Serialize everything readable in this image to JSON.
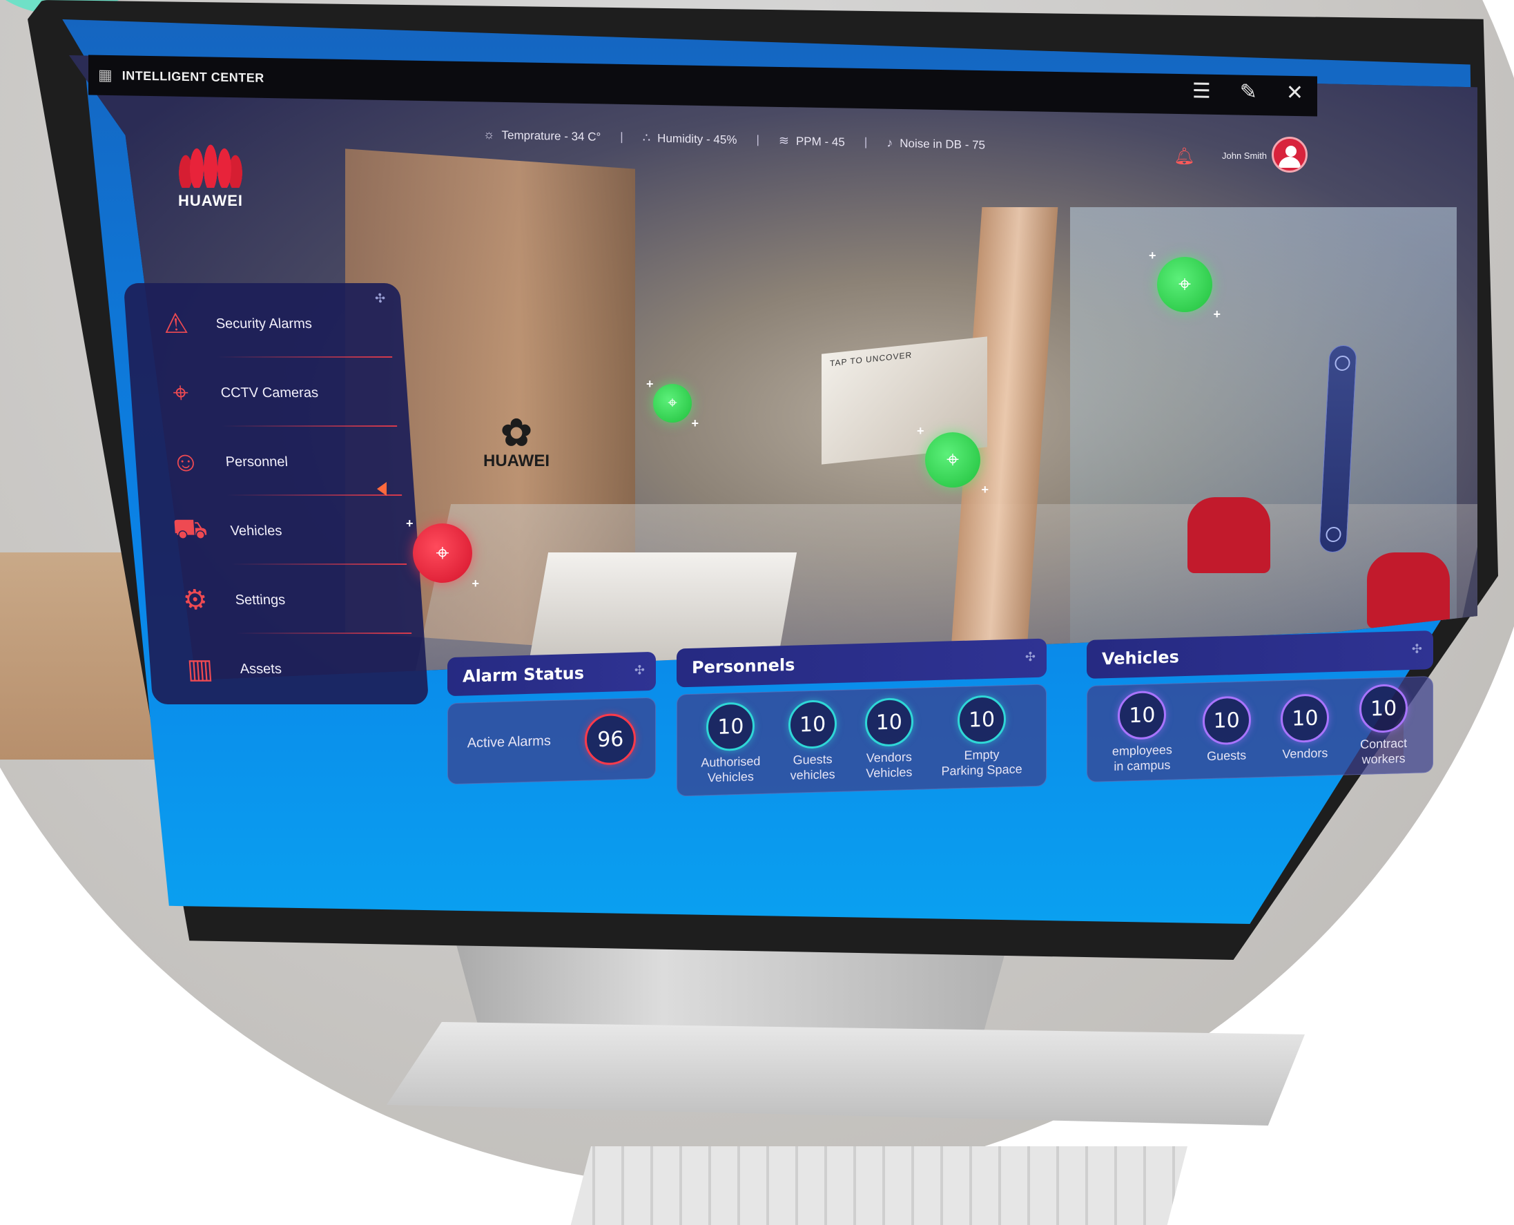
{
  "window": {
    "title": "INTELLIGENT CENTER",
    "app_icon": "building-chart-icon",
    "controls": [
      {
        "name": "filter-settings-icon",
        "glyph": "☰"
      },
      {
        "name": "pin-icon",
        "glyph": "✎"
      },
      {
        "name": "close-icon",
        "glyph": "✕"
      }
    ]
  },
  "brand": {
    "logo_text": "HUAWEI",
    "wall_logo_text": "HUAWEI",
    "primary_color": "#e8233a"
  },
  "environment": [
    {
      "icon": "sun-icon",
      "label": "Temprature - 34 C°"
    },
    {
      "icon": "droplets-icon",
      "label": "Humidity - 45%"
    },
    {
      "icon": "waves-icon",
      "label": "PPM - 45"
    },
    {
      "icon": "microphone-icon",
      "label": "Noise in DB - 75"
    }
  ],
  "user": {
    "name": "John Smith",
    "notification_icon": "bell-icon"
  },
  "scene": {
    "tv_text": "TAP TO UNCOVER"
  },
  "sidebar": {
    "items": [
      {
        "label": "Security Alarms",
        "icon": "alarm-siren-icon",
        "glyph": "⚠"
      },
      {
        "label": "CCTV Cameras",
        "icon": "cctv-camera-icon",
        "glyph": "⌖"
      },
      {
        "label": "Personnel",
        "icon": "personnel-clock-icon",
        "glyph": "☺"
      },
      {
        "label": "Vehicles",
        "icon": "car-icon",
        "glyph": "⛟"
      },
      {
        "label": "Settings",
        "icon": "gears-icon",
        "glyph": "⚙"
      },
      {
        "label": "Assets",
        "icon": "assets-chart-icon",
        "glyph": "▥"
      }
    ]
  },
  "alarm_status": {
    "title": "Alarm Status",
    "label": "Active Alarms",
    "value": "96"
  },
  "personnels": {
    "title": "Personnels",
    "stats": [
      {
        "value": "10",
        "label": "Authorised\nVehicles"
      },
      {
        "value": "10",
        "label": "Guests\nvehicles"
      },
      {
        "value": "10",
        "label": "Vendors\nVehicles"
      },
      {
        "value": "10",
        "label": "Empty\nParking Space"
      }
    ]
  },
  "vehicles": {
    "title": "Vehicles",
    "stats": [
      {
        "value": "10",
        "label": "employees\nin campus"
      },
      {
        "value": "10",
        "label": "Guests"
      },
      {
        "value": "10",
        "label": "Vendors"
      },
      {
        "value": "10",
        "label": "Contract\nworkers"
      }
    ]
  },
  "colors": {
    "panel": "#1c1e58",
    "accent_red": "#ee4a52",
    "ring_teal": "#2fd7d7",
    "ring_purple": "#a974ff",
    "cam_green": "#1fbf3b",
    "cam_red": "#d4122a"
  }
}
